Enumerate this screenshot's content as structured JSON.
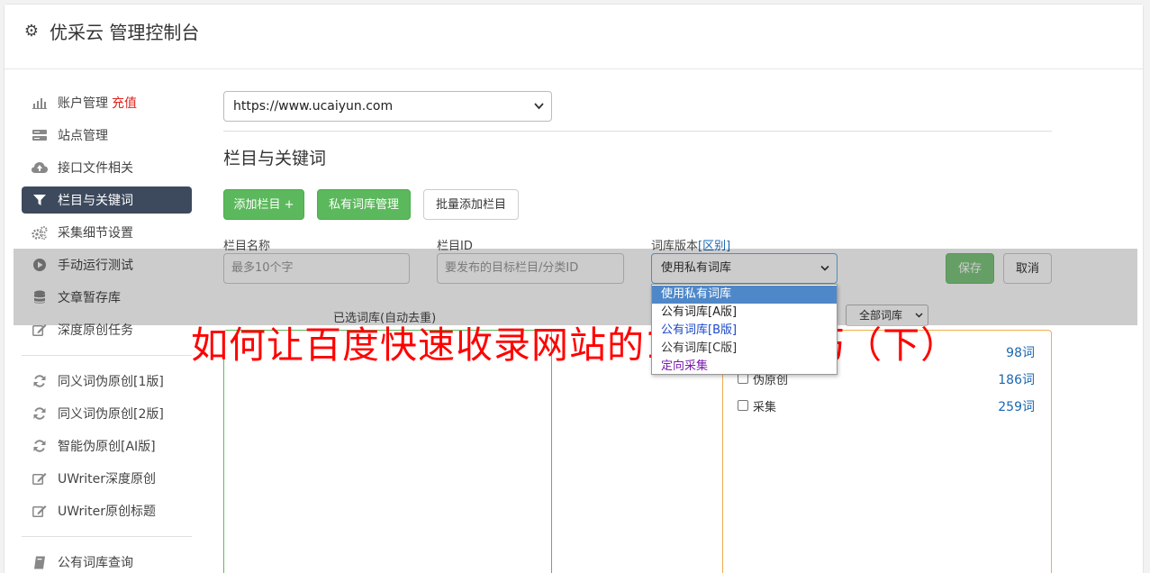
{
  "header": {
    "title": "优采云 管理控制台",
    "icon": "gear-icon"
  },
  "sidebar": {
    "items": [
      {
        "label": "账户管理",
        "badge": "充值",
        "icon": "bar-chart-icon"
      },
      {
        "label": "站点管理",
        "icon": "server-icon"
      },
      {
        "label": "接口文件相关",
        "icon": "cloud-upload-icon"
      },
      {
        "label": "栏目与关键词",
        "icon": "filter-icon",
        "active": true
      },
      {
        "label": "采集细节设置",
        "icon": "cogs-icon"
      },
      {
        "label": "手动运行测试",
        "icon": "play-circle-icon"
      },
      {
        "label": "文章暂存库",
        "icon": "database-icon"
      },
      {
        "label": "深度原创任务",
        "icon": "edit-icon"
      },
      {
        "label": "同义词伪原创[1版]",
        "icon": "refresh-icon"
      },
      {
        "label": "同义词伪原创[2版]",
        "icon": "refresh-icon"
      },
      {
        "label": "智能伪原创[AI版]",
        "icon": "refresh-icon"
      },
      {
        "label": "UWriter深度原创",
        "icon": "edit-icon"
      },
      {
        "label": "UWriter原创标题",
        "icon": "edit-icon"
      },
      {
        "label": "公有词库查询",
        "icon": "book-icon"
      }
    ]
  },
  "main": {
    "site_select": {
      "value": "https://www.ucaiyun.com"
    },
    "section_title": "栏目与关键词",
    "buttons": {
      "add_column": "添加栏目 +",
      "private_lib": "私有词库管理",
      "batch_add": "批量添加栏目",
      "save": "保存",
      "cancel": "取消"
    },
    "form": {
      "name_label": "栏目名称",
      "name_placeholder": "最多10个字",
      "id_label": "栏目ID",
      "id_placeholder": "要发布的目标栏目/分类ID",
      "version_label": "词库版本",
      "version_link": "[区别]",
      "version_value": "使用私有词库"
    },
    "version_options": [
      "使用私有词库",
      "公有词库[A版]",
      "公有词库[B版]",
      "公有词库[C版]",
      "定向采集"
    ],
    "selected_lib_label": "已选词库(自动去重)",
    "lib_filter": "全部词库",
    "libraries": [
      {
        "name": "",
        "count": "98词"
      },
      {
        "name": "伪原创",
        "count": "186词"
      },
      {
        "name": "采集",
        "count": "259词"
      }
    ]
  },
  "watermark": "如何让百度快速收录网站的11个小技巧（下）",
  "colors": {
    "sidebar_active": "#3d4a5d",
    "green": "#5cb85c",
    "link": "#1b67b0",
    "watermark": "#ff0000"
  }
}
